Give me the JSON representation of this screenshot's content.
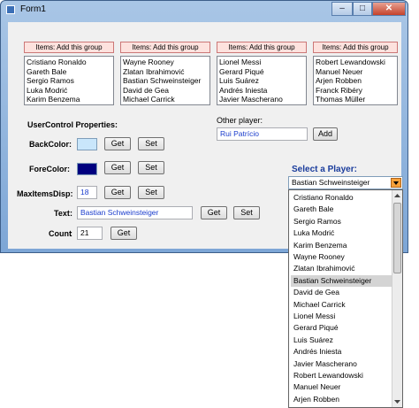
{
  "window": {
    "title": "Form1",
    "min": "–",
    "max": "□",
    "close": "✕"
  },
  "groups": [
    {
      "button": "Items: Add this group",
      "items": [
        "Cristiano Ronaldo",
        "Gareth Bale",
        "Sergio Ramos",
        "Luka Modrić",
        "Karim Benzema"
      ]
    },
    {
      "button": "Items: Add this group",
      "items": [
        "Wayne Rooney",
        "Zlatan Ibrahimović",
        "Bastian Schweinsteiger",
        "David de Gea",
        "Michael Carrick"
      ]
    },
    {
      "button": "Items: Add this group",
      "items": [
        "Lionel Messi",
        "Gerard Piqué",
        "Luis Suárez",
        "Andrés Iniesta",
        "Javier Mascherano"
      ]
    },
    {
      "button": "Items: Add this group",
      "items": [
        "Robert Lewandowski",
        "Manuel Neuer",
        "Arjen Robben",
        "Franck Ribéry",
        "Thomas Müller"
      ]
    }
  ],
  "props": {
    "title": "UserControl Properties:",
    "backcolor_label": "BackColor:",
    "forecolor_label": "ForeColor:",
    "maxitems_label": "MaxItemsDisp:",
    "maxitems_value": "18",
    "text_label": "Text",
    "text_value": "Bastian Schweinsteiger",
    "count_label": "Count",
    "count_value": "21",
    "get": "Get",
    "set": "Set",
    "backcolor": "#c9e6fb",
    "forecolor": "#00007f"
  },
  "other": {
    "label": "Other player:",
    "value": "Rui Patrício",
    "add": "Add"
  },
  "select": {
    "label": "Select a Player:",
    "value": "Bastian Schweinsteiger",
    "options": [
      "Cristiano Ronaldo",
      "Gareth Bale",
      "Sergio Ramos",
      "Luka Modrić",
      "Karim Benzema",
      "Wayne Rooney",
      "Zlatan Ibrahimović",
      "Bastian Schweinsteiger",
      "David de Gea",
      "Michael Carrick",
      "Lionel Messi",
      "Gerard Piqué",
      "Luis Suárez",
      "Andrés Iniesta",
      "Javier Mascherano",
      "Robert Lewandowski",
      "Manuel Neuer",
      "Arjen Robben"
    ],
    "selected_index": 7
  }
}
